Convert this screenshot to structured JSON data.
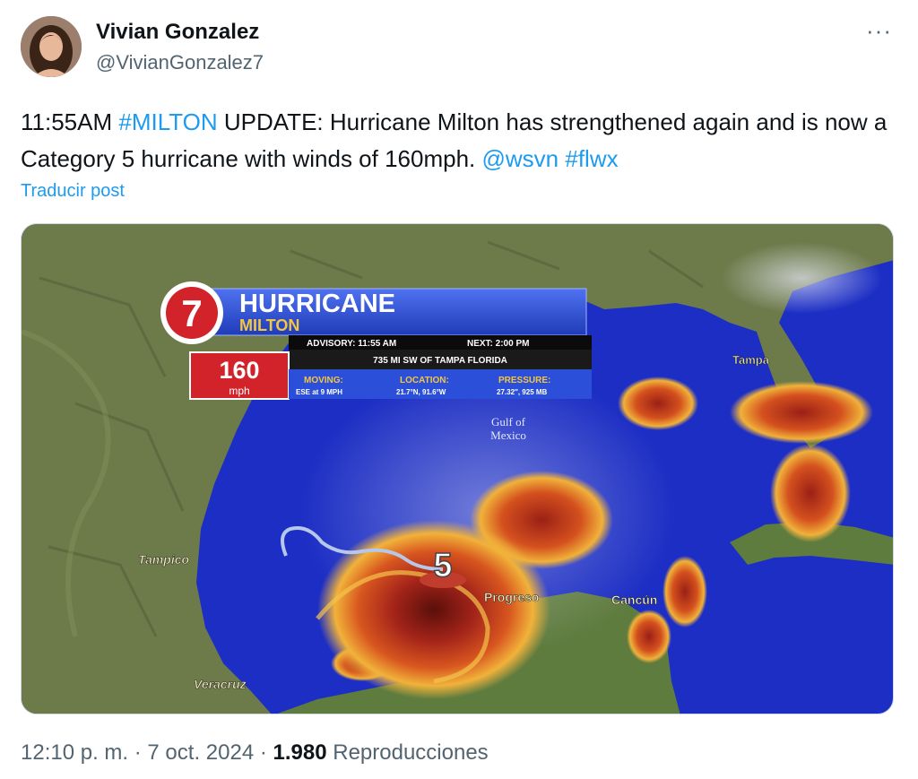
{
  "author": {
    "name": "Vivian Gonzalez",
    "handle": "@VivianGonzalez7",
    "more_icon": "···"
  },
  "tweet": {
    "prefix": "11:55AM ",
    "hashtag1": "#MILTON",
    "body": " UPDATE: Hurricane Milton has strengthened again and is now a Category 5 hurricane with winds of 160mph. ",
    "mention": "@wsvn",
    "space": " ",
    "hashtag2": "#flwx",
    "translate": "Traducir post"
  },
  "graphic": {
    "logo_number": "7",
    "title": "HURRICANE",
    "name": "MILTON",
    "advisory": "ADVISORY: 11:55 AM",
    "next": "NEXT: 2:00 PM",
    "distance": "735 MI SW OF TAMPA FLORIDA",
    "wind_speed": "160",
    "wind_unit": "mph",
    "moving_label": "MOVING:",
    "moving_value": "ESE at 9 MPH",
    "location_label": "LOCATION:",
    "location_value": "21.7°N, 91.6°W",
    "pressure_label": "PRESSURE:",
    "pressure_value": "27.32″, 925 MB",
    "category": "5",
    "gulf_line1": "Gulf of",
    "gulf_line2": "Mexico",
    "city_tampa": "Tampa",
    "city_tampico": "Tampico",
    "city_progreso": "Progreso",
    "city_cancun": "Cancún",
    "city_veracruz": "Veracruz"
  },
  "meta": {
    "time": "12:10 p. m.",
    "sep1": " · ",
    "date": "7 oct. 2024",
    "sep2": " · ",
    "views": "1.980",
    "views_label": " Reproducciones"
  },
  "colors": {
    "link": "#1d9bf0",
    "secondary_text": "#536471",
    "ocean": "#1c2ec4",
    "banner_blue": "#2b4fd8",
    "logo_red": "#d2232a"
  }
}
